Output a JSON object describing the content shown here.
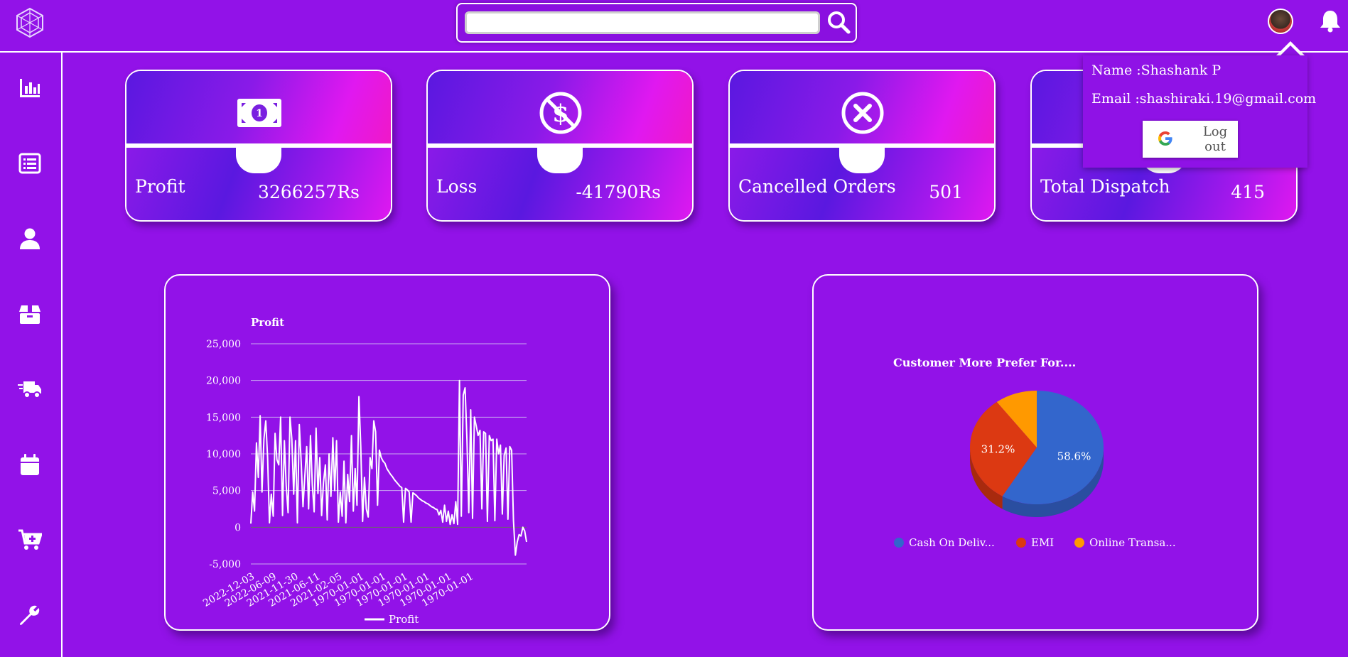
{
  "header": {
    "search": {
      "value": "",
      "placeholder": ""
    },
    "icons": {
      "logo": "hexagon-logo-icon",
      "search": "search-icon",
      "bell": "bell-icon"
    }
  },
  "sidebar": {
    "items": [
      {
        "icon": "bar-chart-icon"
      },
      {
        "icon": "list-icon"
      },
      {
        "icon": "user-icon"
      },
      {
        "icon": "box-icon"
      },
      {
        "icon": "delivery-truck-icon"
      },
      {
        "icon": "calendar-icon"
      },
      {
        "icon": "cart-plus-icon"
      },
      {
        "icon": "wrench-icon"
      }
    ]
  },
  "cards": [
    {
      "label": "Profit",
      "value": "3266257Rs",
      "icon": "money-bill-icon"
    },
    {
      "label": "Loss",
      "value": "-41790Rs",
      "icon": "no-dollar-icon"
    },
    {
      "label": "Cancelled Orders",
      "value": "501",
      "icon": "cancel-circle-icon"
    },
    {
      "label": "Total Dispatch",
      "value": "415",
      "icon": "dispatch-icon"
    }
  ],
  "profile_menu": {
    "name_line": "Name :Shashank P",
    "email_line": "Email :shashiraki.19@gmail.com",
    "logout_label": "Log out"
  },
  "colors": {
    "background": "#9212e8",
    "pie_cash": "#3366cc",
    "pie_emi": "#dc3912",
    "pie_online": "#ff9900"
  },
  "chart_data": [
    {
      "type": "line",
      "title": "Profit",
      "legend": "bottom",
      "series": [
        {
          "name": "Profit",
          "values": [
            500,
            4800,
            2200,
            11500,
            6800,
            15200,
            4800,
            12000,
            14500,
            9500,
            600,
            4500,
            1500,
            12800,
            9200,
            8500,
            15000,
            1600,
            11800,
            5600,
            2000,
            15000,
            12000,
            4500,
            11800,
            600,
            14000,
            9000,
            2800,
            7000,
            11000,
            2500,
            12500,
            5800,
            2100,
            13500,
            4600,
            9500,
            1600,
            6100,
            8500,
            1000,
            10000,
            4200,
            12200,
            5000,
            11800,
            700,
            4800,
            1500,
            9000,
            600,
            7200,
            3500,
            12500,
            2200,
            8000,
            3000,
            17800,
            11000,
            800,
            6800,
            2500,
            1400,
            9500,
            8000,
            14500,
            13000,
            3000,
            10500,
            9500,
            9000,
            8700,
            8000,
            7600,
            7200,
            6900,
            6500,
            6200,
            5900,
            5600,
            5400,
            700,
            5300,
            5100,
            4800,
            700,
            4700,
            4500,
            4300,
            4000,
            3800,
            3600,
            3500,
            3300,
            3200,
            3000,
            2800,
            2700,
            2500,
            2400,
            1700,
            2300,
            700,
            3000,
            800,
            2200,
            400,
            1700,
            500,
            3500,
            400,
            20000,
            1500,
            18000,
            19000,
            12000,
            2000,
            16000,
            1200,
            15000,
            13800,
            12500,
            13200,
            2500,
            13000,
            12800,
            800,
            12500,
            11800,
            12000,
            900,
            12000,
            10000,
            11200,
            1800,
            9800,
            10800,
            1100,
            11000,
            10500,
            900,
            -3800,
            -2000,
            -1000,
            -1200,
            0,
            -500,
            -2000
          ]
        }
      ],
      "x_tick_labels": [
        "2022-12-03",
        "2022-06-09",
        "2021-11-30",
        "2021-06-11",
        "2021-02-05",
        "1970-01-01",
        "1970-01-01",
        "1970-01-01",
        "1970-01-01",
        "1970-01-01",
        "1970-01-01"
      ],
      "y_ticks": [
        25000,
        20000,
        15000,
        10000,
        5000,
        0,
        -5000
      ],
      "y_tick_labels": [
        "25,000",
        "20,000",
        "15,000",
        "10,000",
        "5,000",
        "0",
        "-5,000"
      ],
      "ylim": [
        -5000,
        25000
      ],
      "grid": true
    },
    {
      "type": "pie",
      "title": "Customer More Prefer For....",
      "labels": [
        "Cash On Deliv...",
        "EMI",
        "Online Transa..."
      ],
      "values": [
        58.6,
        31.2,
        10.2
      ],
      "data_labels": [
        "58.6%",
        "31.2%",
        ""
      ],
      "legend": "bottom"
    }
  ]
}
